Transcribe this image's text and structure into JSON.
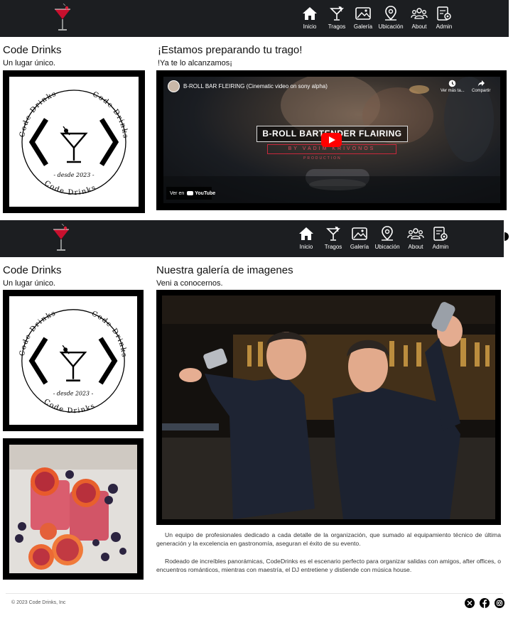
{
  "nav": {
    "items": [
      {
        "label": "Inicio",
        "icon": "home-icon"
      },
      {
        "label": "Tragos",
        "icon": "cocktail-icon"
      },
      {
        "label": "Galería",
        "icon": "gallery-icon"
      },
      {
        "label": "Ubicación",
        "icon": "location-pin-icon"
      },
      {
        "label": "About",
        "icon": "users-icon"
      },
      {
        "label": "Admin",
        "icon": "admin-settings-icon"
      }
    ],
    "background": "#1c1e21"
  },
  "page1": {
    "brand_title": "Code Drinks",
    "brand_sub": "Un lugar único.",
    "title": "¡Estamos preparando tu trago!",
    "subtitle": "!Ya te lo alcanzamos¡",
    "video": {
      "title": "B-ROLL BAR FLEIRING (Cinematic video on sony alpha)",
      "watch_later": "Ver más ta...",
      "share": "Compartir",
      "headline": "B-ROLL BARTENDER FLAIRING",
      "byline": "BY VADIM KRIVONOS",
      "production": "PRODUCTION",
      "watch_on": "Ver en",
      "youtube": "YouTube"
    }
  },
  "logo": {
    "ring_text": "Code Drinks",
    "since": "- desde 2023 -"
  },
  "page2": {
    "brand_title": "Code Drinks",
    "brand_sub": "Un lugar único.",
    "title": "Nuestra galería de imagenes",
    "subtitle": "Veni a conocernos.",
    "paragraphs": [
      "Un equipo de profesionales dedicado a cada detalle de la organización, que sumado al equipamiento técnico de última generación y la excelencia en gastronomía, aseguran el éxito de su evento.",
      "Rodeado de increíbles panorámicas, CodeDrinks es el escenario perfecto para organizar salidas con amigos, after offices, o encuentros románticos, mientras con maestría, el DJ entretiene y distiende con música house."
    ]
  },
  "footer": {
    "copyright": "© 2023 Code Drinks, Inc",
    "social": [
      "x-icon",
      "facebook-icon",
      "instagram-icon"
    ]
  }
}
